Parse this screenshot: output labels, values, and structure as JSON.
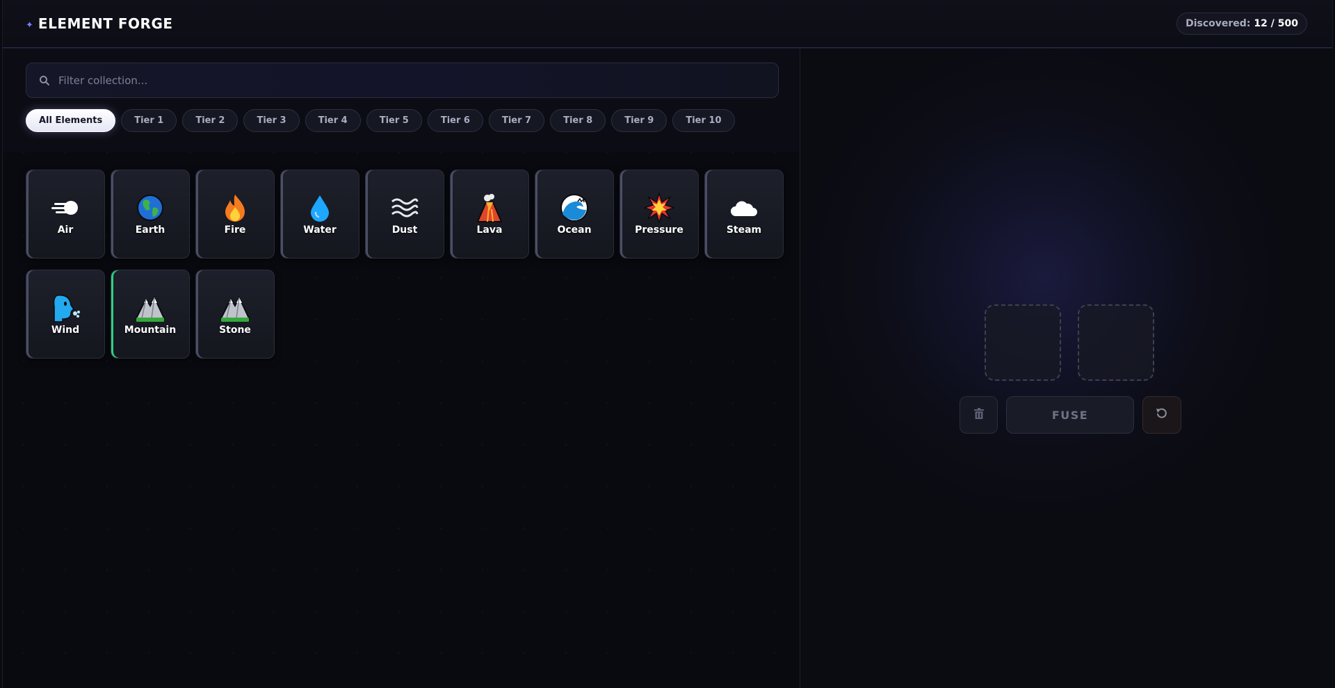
{
  "header": {
    "title": "ELEMENT FORGE",
    "star_icon": "sparkle-icon",
    "discovered_label": "Discovered:",
    "discovered_count": "12 / 500"
  },
  "search": {
    "placeholder": "Filter collection...",
    "value": ""
  },
  "tabs": [
    {
      "label": "All Elements",
      "active": true
    },
    {
      "label": "Tier 1"
    },
    {
      "label": "Tier 2"
    },
    {
      "label": "Tier 3"
    },
    {
      "label": "Tier 4"
    },
    {
      "label": "Tier 5"
    },
    {
      "label": "Tier 6"
    },
    {
      "label": "Tier 7"
    },
    {
      "label": "Tier 8"
    },
    {
      "label": "Tier 9"
    },
    {
      "label": "Tier 10"
    }
  ],
  "elements": [
    {
      "name": "Air",
      "icon": "wind-face-icon"
    },
    {
      "name": "Earth",
      "icon": "globe-icon"
    },
    {
      "name": "Fire",
      "icon": "flame-icon"
    },
    {
      "name": "Water",
      "icon": "droplet-icon"
    },
    {
      "name": "Dust",
      "icon": "waves-icon"
    },
    {
      "name": "Lava",
      "icon": "volcano-icon"
    },
    {
      "name": "Ocean",
      "icon": "wave-icon"
    },
    {
      "name": "Pressure",
      "icon": "explosion-icon"
    },
    {
      "name": "Steam",
      "icon": "cloud-icon"
    },
    {
      "name": "Wind",
      "icon": "blowing-face-icon"
    },
    {
      "name": "Mountain",
      "icon": "mountain-icon",
      "highlight": true
    },
    {
      "name": "Stone",
      "icon": "mountain-icon"
    }
  ],
  "forge": {
    "fuse_label": "FUSE",
    "trash_icon": "trash-icon",
    "reset_icon": "reset-icon"
  },
  "colors": {
    "accent": "#7b7cff",
    "new_highlight": "#2ecf86"
  }
}
